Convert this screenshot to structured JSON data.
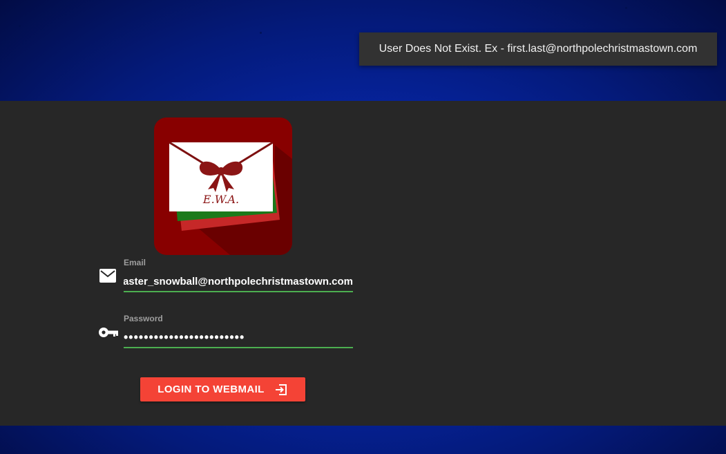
{
  "notification": {
    "message": "User Does Not Exist. Ex - first.last@northpolechristmastown.com"
  },
  "logo": {
    "text": "E.W.A.",
    "icon": "envelope-bow-logo"
  },
  "form": {
    "email": {
      "label": "Email",
      "value": "alabaster_snowball@northpolechristmastown.com",
      "icon": "mail-icon"
    },
    "password": {
      "label": "Password",
      "value": "************************",
      "icon": "key-icon"
    },
    "submit": {
      "label": "LOGIN TO WEBMAIL",
      "icon": "login-arrow-icon"
    }
  },
  "colors": {
    "accent": "#f44336",
    "field_underline": "#4caf50",
    "panel": "#272727",
    "logo_background": "#880000"
  }
}
